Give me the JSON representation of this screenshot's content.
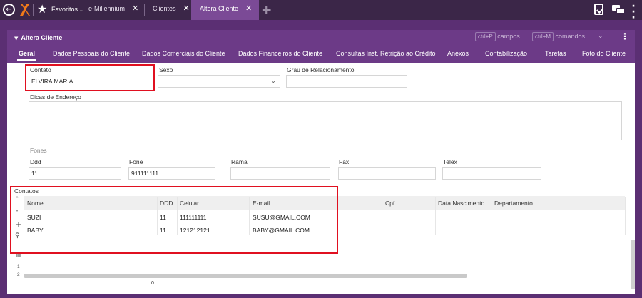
{
  "topbar": {
    "favorites_label": "Favoritos",
    "tabs": [
      {
        "label": "e-Millennium",
        "active": false
      },
      {
        "label": "Clientes",
        "active": false
      },
      {
        "label": "Altera Cliente",
        "active": true
      }
    ],
    "close_symbol": "✕",
    "plus_symbol": "✚"
  },
  "panel": {
    "title": "Altera Cliente",
    "shortcut_fields_key": "ctrl+P",
    "shortcut_fields_label": "campos",
    "shortcut_sep": "|",
    "shortcut_commands_key": "ctrl+M",
    "shortcut_commands_label": "comandos",
    "tabs": [
      "Geral",
      "Dados Pessoais do Cliente",
      "Dados Comerciais do Cliente",
      "Dados Financeiros do Cliente",
      "Consultas Inst. Retrição ao Crédito",
      "Anexos",
      "Contabilização",
      "Tarefas",
      "Foto do Cliente"
    ],
    "active_tab": "Geral"
  },
  "form": {
    "contato_label": "Contato",
    "contato_value": "ELVIRA MARIA",
    "sexo_label": "Sexo",
    "sexo_value": "",
    "grau_label": "Grau de Relacionamento",
    "grau_value": "",
    "dicas_label": "Dicas de Endereço",
    "dicas_value": "",
    "fones_label": "Fones",
    "ddd_label": "Ddd",
    "ddd_value": "11",
    "fone_label": "Fone",
    "fone_value": "911111111",
    "ramal_label": "Ramal",
    "ramal_value": "",
    "fax_label": "Fax",
    "fax_value": "",
    "telex_label": "Telex",
    "telex_value": ""
  },
  "contatos": {
    "title": "Contatos",
    "columns": [
      "Nome",
      "DDD",
      "Celular",
      "E-mail",
      "Cpf",
      "Data Nascimento",
      "Departamento"
    ],
    "rows": [
      {
        "nome": "SUZI",
        "ddd": "11",
        "celular": "111111111",
        "email": "SUSU@GMAIL.COM",
        "cpf": "",
        "nascimento": "",
        "departamento": ""
      },
      {
        "nome": "BABY",
        "ddd": "11",
        "celular": "121212121",
        "email": "BABY@GMAIL.COM",
        "cpf": "",
        "nascimento": "",
        "departamento": ""
      }
    ],
    "row_numbers": [
      "1",
      "2"
    ],
    "footer_value": "0"
  },
  "colors": {
    "accent": "#6c3a87",
    "topbar": "#3b2648",
    "highlight_box": "#e01020"
  }
}
